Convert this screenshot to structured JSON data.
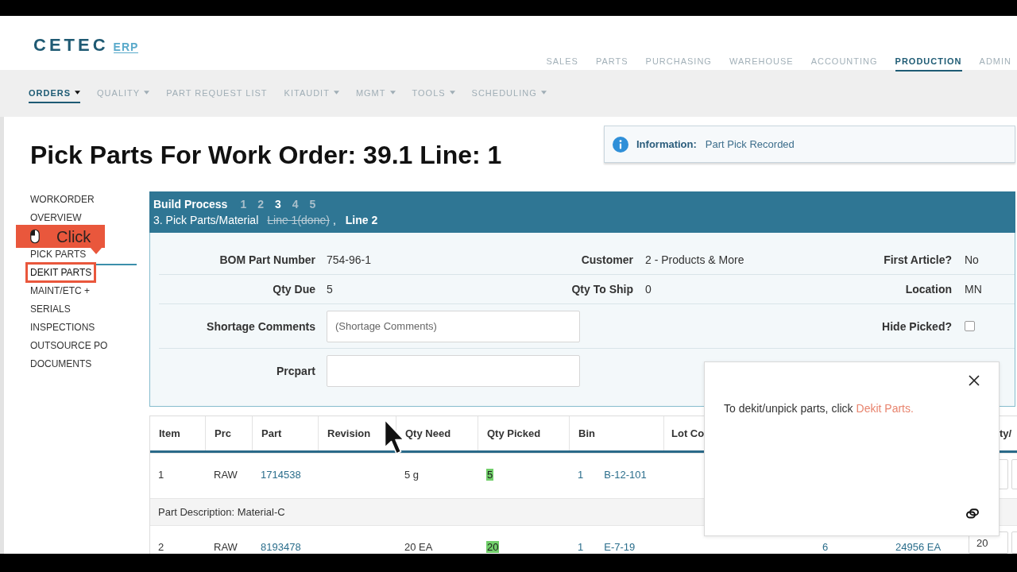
{
  "header": {
    "logo": {
      "wordmark": "CETEC",
      "suffix": "ERP"
    },
    "nav": [
      {
        "label": "SALES",
        "selected": false
      },
      {
        "label": "PARTS",
        "selected": false
      },
      {
        "label": "PURCHASING",
        "selected": false
      },
      {
        "label": "WAREHOUSE",
        "selected": false
      },
      {
        "label": "ACCOUNTING",
        "selected": false
      },
      {
        "label": "PRODUCTION",
        "selected": true
      },
      {
        "label": "ADMIN",
        "selected": false
      }
    ]
  },
  "subnav": [
    {
      "label": "ORDERS",
      "dropdown": true,
      "selected": true
    },
    {
      "label": "QUALITY",
      "dropdown": true,
      "selected": false
    },
    {
      "label": "PART REQUEST LIST",
      "dropdown": false,
      "selected": false
    },
    {
      "label": "KITAUDIT",
      "dropdown": true,
      "selected": false
    },
    {
      "label": "MGMT",
      "dropdown": true,
      "selected": false
    },
    {
      "label": "TOOLS",
      "dropdown": true,
      "selected": false
    },
    {
      "label": "SCHEDULING",
      "dropdown": true,
      "selected": false
    }
  ],
  "page_title": "Pick Parts For Work Order: 39.1 Line: 1",
  "notice": {
    "label": "Information:",
    "message": "Part Pick Recorded"
  },
  "sidebar": {
    "items": [
      {
        "label": "WORKORDER OVERVIEW",
        "selected": false,
        "highlighted": false
      },
      {
        "label": "PICK PARTS",
        "selected": true,
        "highlighted": false
      },
      {
        "label": "DEKIT PARTS",
        "selected": false,
        "highlighted": true
      },
      {
        "label": "MAINT/ETC +",
        "selected": false,
        "highlighted": false
      },
      {
        "label": "SERIALS",
        "selected": false,
        "highlighted": false
      },
      {
        "label": "INSPECTIONS",
        "selected": false,
        "highlighted": false
      },
      {
        "label": "OUTSOURCE PO",
        "selected": false,
        "highlighted": false
      },
      {
        "label": "DOCUMENTS",
        "selected": false,
        "highlighted": false
      }
    ],
    "callout": {
      "label": "Click"
    }
  },
  "build_process": {
    "title": "Build Process",
    "steps": [
      {
        "label": "1",
        "selected": false
      },
      {
        "label": "2",
        "selected": false
      },
      {
        "label": "3",
        "selected": true
      },
      {
        "label": "4",
        "selected": false
      },
      {
        "label": "5",
        "selected": false
      }
    ],
    "stage": "3. Pick Parts/Material",
    "lines": [
      {
        "label": "Line 1(done)",
        "done": true
      },
      {
        "label": "Line 2",
        "done": false
      }
    ],
    "separator": ","
  },
  "details": {
    "rows": [
      {
        "left": {
          "kind": "text",
          "label": "BOM Part Number",
          "value": "754-96-1"
        },
        "center": {
          "kind": "text",
          "label": "Customer",
          "value": "2 - Products & More"
        },
        "right": {
          "kind": "text",
          "label": "First Article?",
          "value": "No"
        }
      },
      {
        "left": {
          "kind": "text",
          "label": "Qty Due",
          "value": "5"
        },
        "center": {
          "kind": "text",
          "label": "Qty To Ship",
          "value": "0"
        },
        "right": {
          "kind": "text",
          "label": "Location",
          "value": "MN"
        }
      },
      {
        "left": {
          "kind": "input",
          "label": "Shortage Comments",
          "placeholder": "(Shortage Comments)"
        },
        "right": {
          "kind": "checkbox",
          "label": "Hide Picked?",
          "checked": false
        }
      },
      {
        "left": {
          "kind": "input",
          "label": "Prcpart"
        }
      }
    ]
  },
  "table": {
    "headers": {
      "item": "Item",
      "prc": "Prc",
      "part": "Part",
      "revision": "Revision",
      "qty_need": "Qty Need",
      "qty_picked": "Qty Picked",
      "bin": "Bin",
      "lot": "Lot Co",
      "column_11": "ty/"
    },
    "rows": [
      {
        "kind": "part",
        "item": "1",
        "prc": "RAW",
        "part": "1714538",
        "qty_need": "5 g",
        "qty_picked": "5",
        "picked": true,
        "bin_qty": "1",
        "bin": "B-12-101"
      },
      {
        "kind": "description",
        "text": "Part Description: Material-C"
      },
      {
        "kind": "part",
        "item": "2",
        "prc": "RAW",
        "part": "8193478",
        "qty_need": "20 EA",
        "qty_picked": "20",
        "picked": true,
        "bin_qty": "1",
        "bin": "E-7-19",
        "column_9": "6",
        "column_10": "24956 EA",
        "column_11": "20"
      }
    ]
  },
  "popup": {
    "message": "To dekit/unpick parts, click",
    "link": "Dekit Parts."
  }
}
